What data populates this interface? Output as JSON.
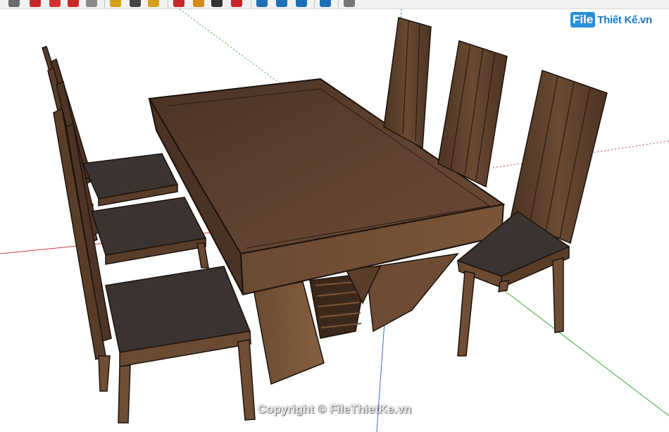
{
  "toolbar": {
    "tools": [
      {
        "name": "layer-icon",
        "color": "#6b6b6b"
      },
      {
        "name": "wifi-icon",
        "color": "#c62828"
      },
      {
        "name": "scissors-icon",
        "color": "#d32f2f"
      },
      {
        "name": "redo-icon",
        "color": "#c62828"
      },
      {
        "name": "box-icon",
        "color": "#8a8a8a"
      },
      {
        "name": "pencil-icon",
        "color": "#d4a017"
      },
      {
        "name": "tape-icon",
        "color": "#444444"
      },
      {
        "name": "paint-bucket-icon",
        "color": "#d4a017"
      },
      {
        "name": "push-pull-icon",
        "color": "#c62828"
      },
      {
        "name": "follow-me-icon",
        "color": "#d68a1a"
      },
      {
        "name": "magnify-icon",
        "color": "#333333"
      },
      {
        "name": "move-icon",
        "color": "#c62828"
      },
      {
        "name": "orbit-icon",
        "color": "#1f6fb5"
      },
      {
        "name": "pan-icon",
        "color": "#1f6fb5"
      },
      {
        "name": "zoom-extents-icon",
        "color": "#1f6fb5"
      },
      {
        "name": "settings-icon",
        "color": "#1f6fb5"
      },
      {
        "name": "globe-icon",
        "color": "#777777"
      }
    ]
  },
  "scene": {
    "description_icon": "3d-model-icon",
    "wood_dark": "#3e2a1e",
    "wood_mid": "#5a3d29",
    "wood_light": "#7a563a",
    "seat_fabric": "#3a3330",
    "axis_red": "#d63a3a",
    "axis_green": "#3aa83a",
    "axis_blue": "#3a6ad6"
  },
  "watermark": {
    "logo_file": "File",
    "logo_rest": "Thiết Kế.vn",
    "copyright": "Copyright © FileThietKe.vn"
  }
}
